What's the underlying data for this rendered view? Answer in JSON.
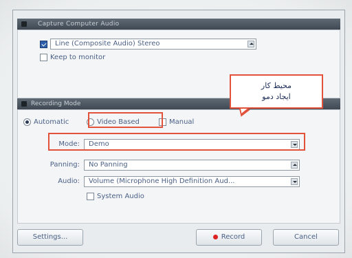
{
  "section1": {
    "header": "Capture Computer Audio",
    "device_value": "Line (Composite Audio) Stereo",
    "stereo_label": "Stereo",
    "stay_at_monitor_label": "Keep to monitor"
  },
  "section2": {
    "header": "Recording Mode",
    "mode_automatic": "Automatic",
    "mode_video_based": "Video Based",
    "mode_manual": "Manual",
    "mode_label": "Mode:",
    "mode_value": "Demo",
    "panning_label": "Panning:",
    "panning_value": "No Panning",
    "audio_label": "Audio:",
    "audio_value": "Volume (Microphone High Definition Aud...",
    "system_audio_label": "System Audio"
  },
  "buttons": {
    "settings": "Settings...",
    "record": "Record",
    "cancel": "Cancel"
  },
  "callout": {
    "line1": "محیط کار",
    "line2": "ایجاد دمو"
  },
  "colors": {
    "highlight": "#e2513a",
    "record_dot": "#dd2222",
    "header_bg": "#4a5560"
  }
}
